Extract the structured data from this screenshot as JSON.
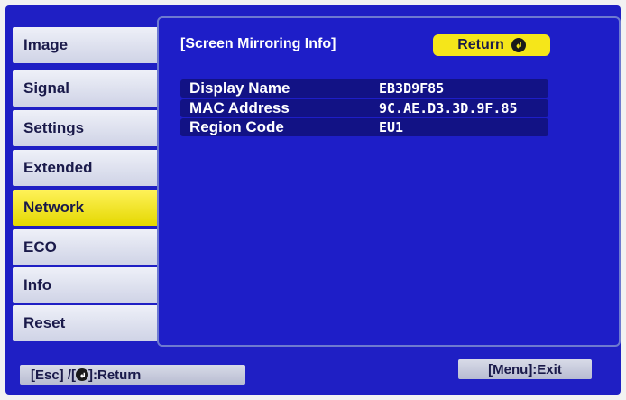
{
  "menu": {
    "items": [
      {
        "label": "Image"
      },
      {
        "label": "Signal"
      },
      {
        "label": "Settings"
      },
      {
        "label": "Extended"
      },
      {
        "label": "Network",
        "active": true
      },
      {
        "label": "ECO"
      },
      {
        "label": "Info"
      },
      {
        "label": "Reset"
      }
    ]
  },
  "panel": {
    "title": "[Screen Mirroring Info]",
    "return_label": "Return",
    "rows": [
      {
        "label": "Display Name",
        "value": "EB3D9F85"
      },
      {
        "label": "MAC Address",
        "value": "9C.AE.D3.3D.9F.85"
      },
      {
        "label": "Region Code",
        "value": "EU1"
      }
    ]
  },
  "footer": {
    "left_prefix": "[Esc] /[",
    "left_suffix": "]:Return",
    "right": "[Menu]:Exit"
  },
  "colors": {
    "background": "#1f1fc4",
    "active_menu": "#f5e61a",
    "menu_item": "#d9dcec"
  },
  "icons": {
    "enter": "enter-icon"
  }
}
